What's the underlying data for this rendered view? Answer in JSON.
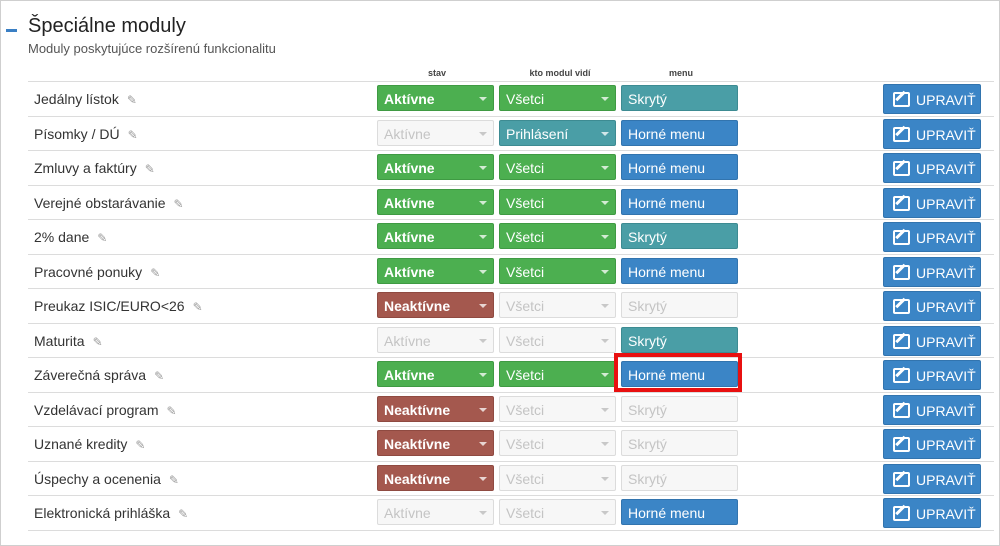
{
  "section": {
    "title": "Špeciálne moduly",
    "subtitle": "Moduly poskytujúce rozšírenú funkcionalitu"
  },
  "columns": {
    "stav": "stav",
    "kto": "kto modul vidí",
    "menu": "menu"
  },
  "edit_label": "UPRAVIŤ",
  "rows": [
    {
      "name": "Jedálny lístok",
      "stav": "Aktívne",
      "stav_style": "green",
      "kto": "Všetci",
      "kto_style": "green-k",
      "menu": "Skrytý",
      "menu_style": "teal"
    },
    {
      "name": "Písomky / DÚ",
      "stav": "Aktívne",
      "stav_style": "disabled",
      "kto": "Prihlásení",
      "kto_style": "teal",
      "menu": "Horné menu",
      "menu_style": "blue"
    },
    {
      "name": "Zmluvy a faktúry",
      "stav": "Aktívne",
      "stav_style": "green",
      "kto": "Všetci",
      "kto_style": "green-k",
      "menu": "Horné menu",
      "menu_style": "blue"
    },
    {
      "name": "Verejné obstarávanie",
      "stav": "Aktívne",
      "stav_style": "green",
      "kto": "Všetci",
      "kto_style": "green-k",
      "menu": "Horné menu",
      "menu_style": "blue"
    },
    {
      "name": "2% dane",
      "stav": "Aktívne",
      "stav_style": "green",
      "kto": "Všetci",
      "kto_style": "green-k",
      "menu": "Skrytý",
      "menu_style": "teal"
    },
    {
      "name": "Pracovné ponuky",
      "stav": "Aktívne",
      "stav_style": "green",
      "kto": "Všetci",
      "kto_style": "green-k",
      "menu": "Horné menu",
      "menu_style": "blue"
    },
    {
      "name": "Preukaz ISIC/EURO<26",
      "stav": "Neaktívne",
      "stav_style": "red",
      "kto": "Všetci",
      "kto_style": "disabled",
      "menu": "Skrytý",
      "menu_style": "disabled"
    },
    {
      "name": "Maturita",
      "stav": "Aktívne",
      "stav_style": "disabled",
      "kto": "Všetci",
      "kto_style": "disabled",
      "menu": "Skrytý",
      "menu_style": "teal"
    },
    {
      "name": "Záverečná správa",
      "stav": "Aktívne",
      "stav_style": "green",
      "kto": "Všetci",
      "kto_style": "green-k",
      "menu": "Horné menu",
      "menu_style": "blue"
    },
    {
      "name": "Vzdelávací program",
      "stav": "Neaktívne",
      "stav_style": "red",
      "kto": "Všetci",
      "kto_style": "disabled",
      "menu": "Skrytý",
      "menu_style": "disabled"
    },
    {
      "name": "Uznané kredity",
      "stav": "Neaktívne",
      "stav_style": "red",
      "kto": "Všetci",
      "kto_style": "disabled",
      "menu": "Skrytý",
      "menu_style": "disabled"
    },
    {
      "name": "Úspechy a ocenenia",
      "stav": "Neaktívne",
      "stav_style": "red",
      "kto": "Všetci",
      "kto_style": "disabled",
      "menu": "Skrytý",
      "menu_style": "disabled"
    },
    {
      "name": "Elektronická prihláška",
      "stav": "Aktívne",
      "stav_style": "disabled",
      "kto": "Všetci",
      "kto_style": "disabled",
      "menu": "Horné menu",
      "menu_style": "blue"
    }
  ],
  "highlighted_row": 8,
  "colors": {
    "accent": "#3b85c6",
    "active": "#4caf50",
    "inactive": "#a4584e",
    "hidden": "#4a9ea6",
    "highlight": "#e81010"
  },
  "icons": {
    "collapse": "minus-icon",
    "edit_name": "pencil-icon",
    "edit_button": "edit-icon",
    "select": "caret-down-icon"
  }
}
